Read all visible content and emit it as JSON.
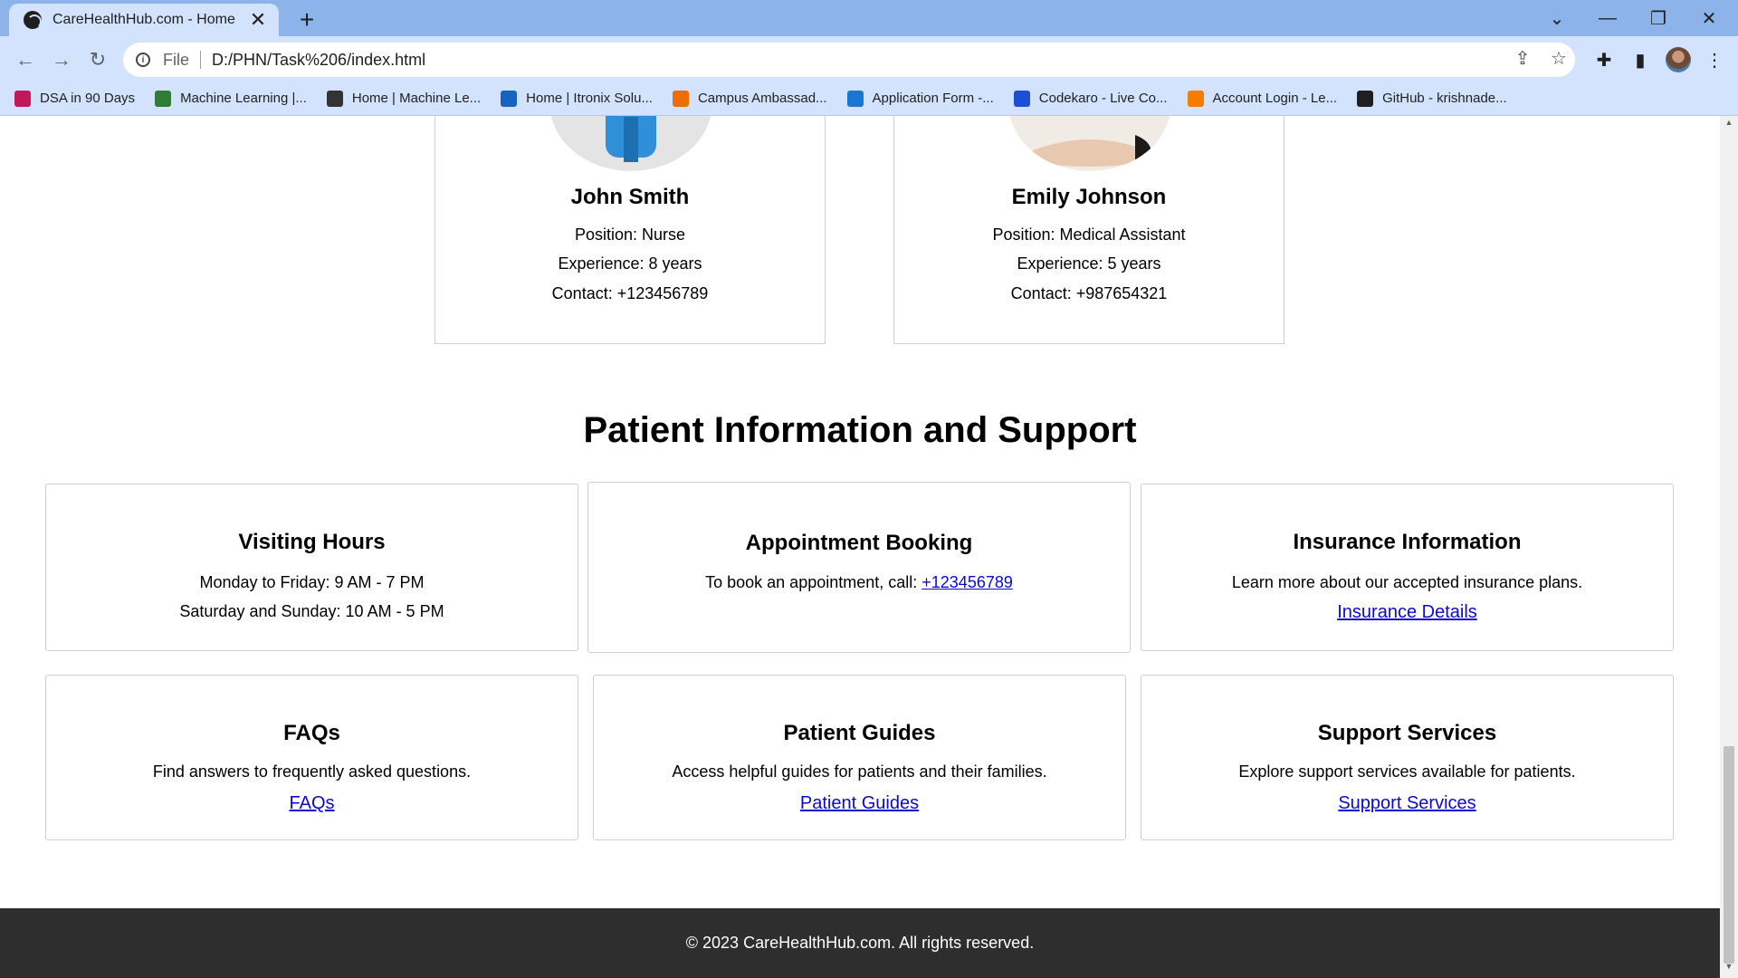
{
  "browser": {
    "tab_title": "CareHealthHub.com - Home",
    "scheme": "File",
    "url": "D:/PHN/Task%206/index.html",
    "bookmarks": [
      {
        "label": "DSA in 90 Days",
        "color": "#c2185b"
      },
      {
        "label": "Machine Learning |...",
        "color": "#2e7d32"
      },
      {
        "label": "Home | Machine Le...",
        "color": "#333333"
      },
      {
        "label": "Home | Itronix Solu...",
        "color": "#1565c0"
      },
      {
        "label": "Campus Ambassad...",
        "color": "#ef6c00"
      },
      {
        "label": "Application Form -...",
        "color": "#1976d2"
      },
      {
        "label": "Codekaro - Live Co...",
        "color": "#1a4fd6"
      },
      {
        "label": "Account Login - Le...",
        "color": "#f57c00"
      },
      {
        "label": "GitHub - krishnade...",
        "color": "#1f1f1f"
      }
    ]
  },
  "staff": [
    {
      "name": "John Smith",
      "position": "Position: Nurse",
      "experience": "Experience: 8 years",
      "contact": "Contact: +123456789"
    },
    {
      "name": "Emily Johnson",
      "position": "Position: Medical Assistant",
      "experience": "Experience: 5 years",
      "contact": "Contact: +987654321"
    }
  ],
  "section_title": "Patient Information and Support",
  "cards": {
    "visiting": {
      "title": "Visiting Hours",
      "line1": "Monday to Friday: 9 AM - 7 PM",
      "line2": "Saturday and Sunday: 10 AM - 5 PM"
    },
    "appointment": {
      "title": "Appointment Booking",
      "text": "To book an appointment, call: ",
      "phone": "+123456789"
    },
    "insurance": {
      "title": "Insurance Information",
      "text": "Learn more about our accepted insurance plans.",
      "link": "Insurance Details"
    },
    "faqs": {
      "title": "FAQs",
      "text": "Find answers to frequently asked questions.",
      "link": "FAQs"
    },
    "guides": {
      "title": "Patient Guides",
      "text": "Access helpful guides for patients and their families.",
      "link": "Patient Guides"
    },
    "support": {
      "title": "Support Services",
      "text": "Explore support services available for patients.",
      "link": "Support Services"
    }
  },
  "footer": "© 2023 CareHealthHub.com. All rights reserved."
}
